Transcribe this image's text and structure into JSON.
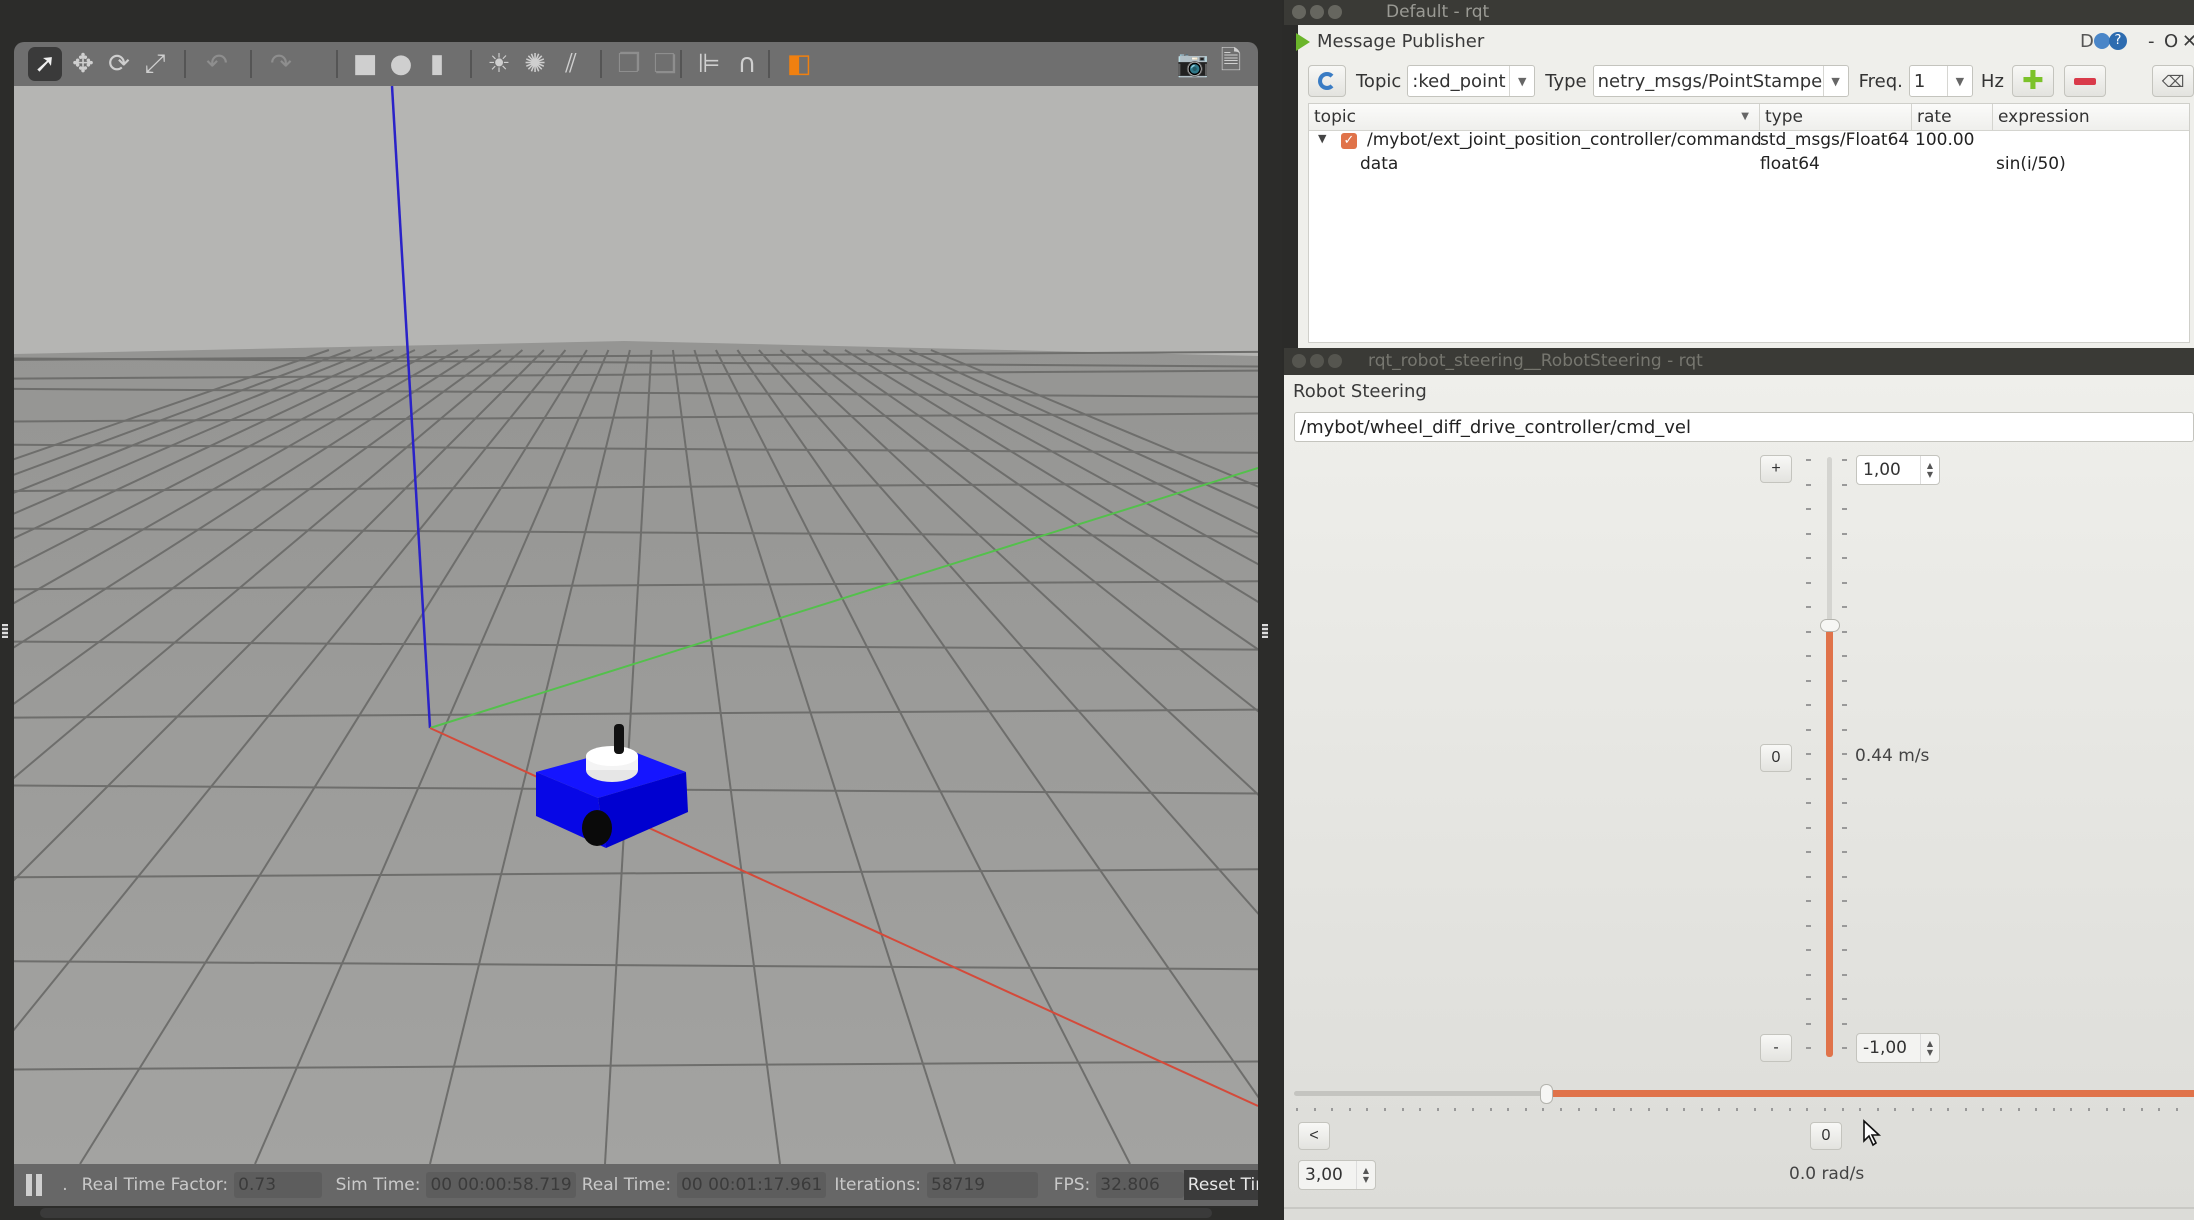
{
  "gazebo": {
    "toolbar": {
      "tools": [
        {
          "name": "select-mode",
          "icon": "arrow-cursor-icon",
          "glyph": "➚"
        },
        {
          "name": "translate-mode",
          "icon": "move-arrows-icon",
          "glyph": "✥"
        },
        {
          "name": "rotate-mode",
          "icon": "rotate-icon",
          "glyph": "⟳"
        },
        {
          "name": "scale-mode",
          "icon": "scale-icon",
          "glyph": "⤢"
        },
        {
          "name": "undo",
          "icon": "undo-icon",
          "glyph": "↶"
        },
        {
          "name": "redo",
          "icon": "redo-icon",
          "glyph": "↷"
        },
        {
          "name": "box-shape",
          "icon": "box-icon",
          "glyph": "■"
        },
        {
          "name": "sphere-shape",
          "icon": "sphere-icon",
          "glyph": "●"
        },
        {
          "name": "cylinder-shape",
          "icon": "cylinder-icon",
          "glyph": "▮"
        },
        {
          "name": "point-light",
          "icon": "sun-light-icon",
          "glyph": "☀"
        },
        {
          "name": "spot-light",
          "icon": "spot-light-icon",
          "glyph": "✺"
        },
        {
          "name": "directional-light",
          "icon": "directional-light-icon",
          "glyph": "⫽"
        },
        {
          "name": "copy",
          "icon": "copy-icon",
          "glyph": "❐"
        },
        {
          "name": "paste",
          "icon": "paste-icon",
          "glyph": "❏"
        },
        {
          "name": "align",
          "icon": "align-icon",
          "glyph": "⊫"
        },
        {
          "name": "snap",
          "icon": "magnet-icon",
          "glyph": "∩"
        },
        {
          "name": "view-angle",
          "icon": "view-cube-icon",
          "glyph": "◧"
        },
        {
          "name": "screenshot",
          "icon": "camera-icon",
          "glyph": "📷"
        },
        {
          "name": "log",
          "icon": "log-download-icon",
          "glyph": "🗎"
        }
      ]
    },
    "status": {
      "rtf_label": "Real Time Factor:",
      "rtf": "0.73",
      "sim_time_label": "Sim Time:",
      "sim_time": "00 00:00:58.719",
      "real_time_label": "Real Time:",
      "real_time": "00 00:01:17.961",
      "iterations_label": "Iterations:",
      "iterations": "58719",
      "fps_label": "FPS:",
      "fps": "32.806",
      "reset_label": "Reset Time",
      "dot": "."
    },
    "colors": {
      "x_axis": "#d44a3a",
      "y_axis": "#54c04c",
      "z_axis": "#2a22c8",
      "robot_body": "#0a0af0",
      "ground": "#9a9a98",
      "sky": "#b4b4b2"
    }
  },
  "message_publisher": {
    "window_title": "Default - rqt",
    "plugin_title": "Message Publisher",
    "plugin_controls": {
      "d": "D",
      "help": "?",
      "minus": "-",
      "o": "O",
      "close": "✕"
    },
    "topic_label": "Topic",
    "topic_value": ":ked_point",
    "type_label": "Type",
    "type_value": "netry_msgs/PointStamped",
    "freq_label": "Freq.",
    "freq_value": "1",
    "hz_label": "Hz",
    "columns": [
      "topic",
      "type",
      "rate",
      "expression"
    ],
    "rows": [
      {
        "topic": "/mybot/ext_joint_position_controller/command",
        "type": "std_msgs/Float64",
        "rate": "100.00",
        "expression": "",
        "checked": true,
        "expanded": true
      },
      {
        "topic": "data",
        "type": "float64",
        "rate": "",
        "expression": "sin(i/50)"
      }
    ]
  },
  "robot_steering": {
    "window_title": "rqt_robot_steering__RobotSteering - rqt",
    "plugin_title": "Robot Steering",
    "topic": "/mybot/wheel_diff_drive_controller/cmd_vel",
    "linear": {
      "max": "1,00",
      "min": "-1,00",
      "plus_label": "+",
      "zero_label": "0",
      "minus_label": "-",
      "value_text": "0.44 m/s",
      "value": 0.44,
      "range": [
        -1,
        1
      ]
    },
    "angular": {
      "left_label": "<",
      "zero_label": "0",
      "max": "3,00",
      "value_text": "0.0 rad/s",
      "value": 0.0,
      "range": [
        -3,
        3
      ]
    },
    "accent": "#e0734a"
  }
}
